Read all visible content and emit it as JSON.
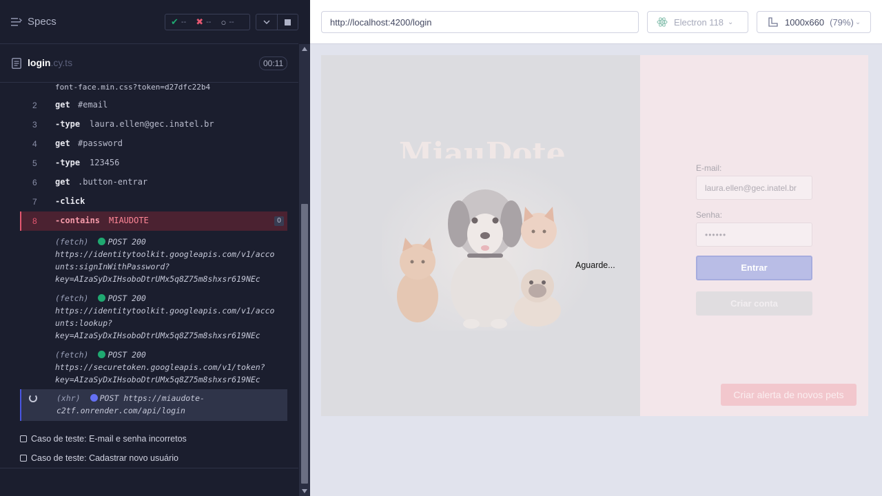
{
  "reporter": {
    "specs_label": "Specs",
    "stats": {
      "passed": "--",
      "failed": "--",
      "pending": "--"
    },
    "spec_file": {
      "base": "login",
      "ext": ".cy.ts",
      "duration": "00:11"
    },
    "top_fragment": "font-face.min.css?token=d27dfc22b4",
    "commands": [
      {
        "num": "2",
        "name": "get",
        "msg": "#email"
      },
      {
        "num": "3",
        "name": "-type",
        "msg": "laura.ellen@gec.inatel.br"
      },
      {
        "num": "4",
        "name": "get",
        "msg": "#password"
      },
      {
        "num": "5",
        "name": "-type",
        "msg": "123456"
      },
      {
        "num": "6",
        "name": "get",
        "msg": ".button-entrar"
      },
      {
        "num": "7",
        "name": "-click",
        "msg": ""
      },
      {
        "num": "8",
        "name": "-contains",
        "msg": "MIAUDOTE",
        "badge": "0"
      }
    ],
    "requests": [
      {
        "kind": "(fetch)",
        "status": "POST 200",
        "url_lines": [
          "https://identitytoolkit.googleapis.com/v1/acco",
          "unts:signInWithPassword?",
          "key=AIzaSyDxIHsoboDtrUMx5q8Z75m8shxsr619NEc"
        ]
      },
      {
        "kind": "(fetch)",
        "status": "POST 200",
        "url_lines": [
          "https://identitytoolkit.googleapis.com/v1/acco",
          "unts:lookup?",
          "key=AIzaSyDxIHsoboDtrUMx5q8Z75m8shxsr619NEc"
        ]
      },
      {
        "kind": "(fetch)",
        "status": "POST 200",
        "url_lines": [
          "https://securetoken.googleapis.com/v1/token?",
          "key=AIzaSyDxIHsoboDtrUMx5q8Z75m8shxsr619NEc"
        ]
      }
    ],
    "pending_request": {
      "kind": "(xhr)",
      "line1": "POST https://miaudote-",
      "line2": "c2tf.onrender.com/api/login"
    },
    "test_cases": [
      "Caso de teste: E-mail e senha incorretos",
      "Caso de teste: Cadastrar novo usuário"
    ]
  },
  "aut": {
    "url": "http://localhost:4200/login",
    "browser": "Electron 118",
    "viewport": "1000x660",
    "zoom": "(79%)",
    "app": {
      "brand": "MiauDote",
      "loading": "Aguarde...",
      "email_label": "E-mail:",
      "email_value": "laura.ellen@gec.inatel.br",
      "password_label": "Senha:",
      "password_value": "••••••",
      "login_button": "Entrar",
      "create_account_button": "Criar conta",
      "alert_button": "Criar alerta de novos pets"
    }
  },
  "colors": {
    "failed": "#e45770",
    "passed": "#1fa971",
    "pending": "#6470f3"
  }
}
